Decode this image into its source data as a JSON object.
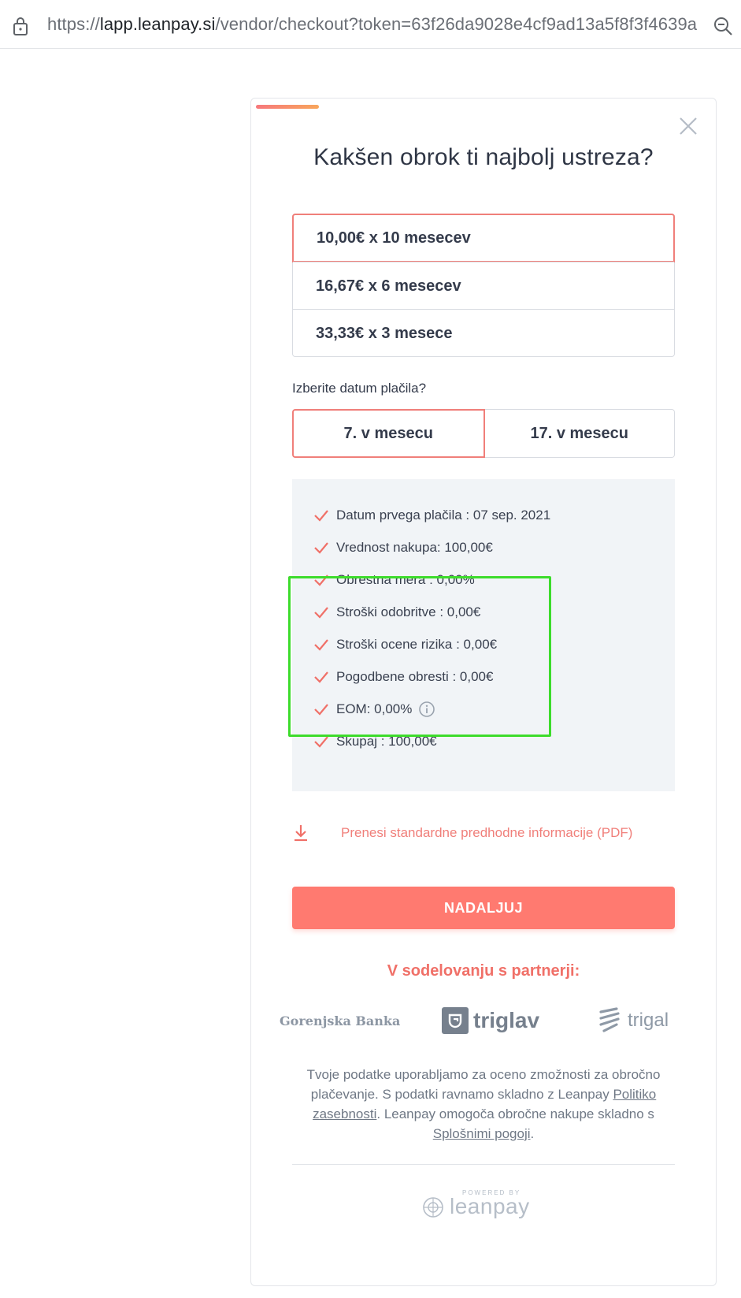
{
  "browser": {
    "url_prefix": "https://",
    "url_host": "lapp.leanpay.si",
    "url_path": "/vendor/checkout?token=63f26da9028e4cf9ad13a5f8f3f4639a"
  },
  "checkout": {
    "title": "Kakšen obrok ti najbolj ustreza?",
    "installments": [
      {
        "label": "10,00€ x 10 mesecev",
        "selected": true
      },
      {
        "label": "16,67€ x 6 mesecev",
        "selected": false
      },
      {
        "label": "33,33€ x 3 mesece",
        "selected": false
      }
    ],
    "date_question": "Izberite datum plačila?",
    "date_options": [
      {
        "label": "7. v mesecu",
        "selected": true
      },
      {
        "label": "17. v mesecu",
        "selected": false
      }
    ],
    "summary": [
      "Datum prvega plačila : 07 sep. 2021",
      "Vrednost nakupa: 100,00€",
      "Obrestna mera : 0,00%",
      "Stroški odobritve : 0,00€",
      "Stroški ocene rizika : 0,00€",
      "Pogodbene obresti : 0,00€",
      "EOM: 0,00%",
      "Skupaj : 100,00€"
    ],
    "pdf_link": "Prenesi standardne predhodne informacije (PDF)",
    "continue_label": "NADALJUJ",
    "partners_title": "V sodelovanju s partnerji:",
    "partners": [
      "Gorenjska Banka",
      "triglav",
      "trigal"
    ],
    "privacy": {
      "text1": "Tvoje podatke uporabljamo za oceno zmožnosti za obročno plačevanje. S podatki ravnamo skladno z Leanpay ",
      "link1": "Politiko zasebnosti",
      "text2": ". Leanpay omogoča obročne nakupe skladno s ",
      "link2": "Splošnimi pogoji",
      "text3": "."
    },
    "powered_by": "POWERED BY",
    "brand": "leanpay"
  },
  "colors": {
    "accent": "#f07f7a",
    "button": "#ff7a70",
    "highlight": "#3ddc2c",
    "summary_bg": "#f1f4f7"
  }
}
